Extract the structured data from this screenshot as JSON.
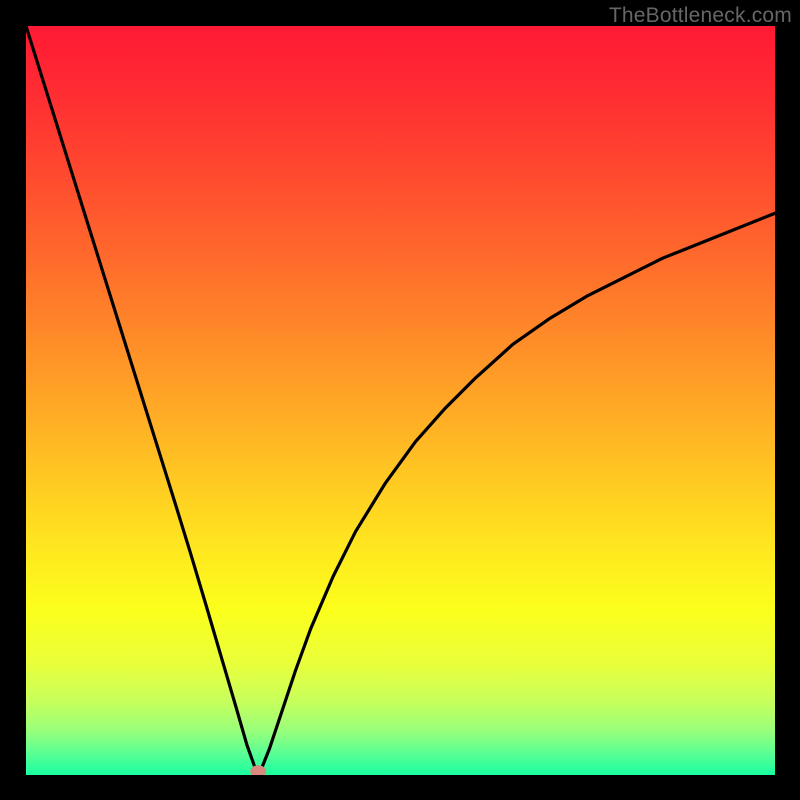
{
  "watermark": {
    "text": "TheBottleneck.com"
  },
  "colors": {
    "gradient_stops": [
      {
        "offset": 0.0,
        "color": "#ff1934"
      },
      {
        "offset": 0.1,
        "color": "#ff2f32"
      },
      {
        "offset": 0.2,
        "color": "#ff4a2f"
      },
      {
        "offset": 0.3,
        "color": "#ff672c"
      },
      {
        "offset": 0.4,
        "color": "#ff8629"
      },
      {
        "offset": 0.5,
        "color": "#ffa626"
      },
      {
        "offset": 0.6,
        "color": "#ffc722"
      },
      {
        "offset": 0.7,
        "color": "#ffe81f"
      },
      {
        "offset": 0.78,
        "color": "#fbff1c"
      },
      {
        "offset": 0.85,
        "color": "#eaff3a"
      },
      {
        "offset": 0.9,
        "color": "#c8ff5a"
      },
      {
        "offset": 0.94,
        "color": "#9aff7a"
      },
      {
        "offset": 0.97,
        "color": "#5cff93"
      },
      {
        "offset": 1.0,
        "color": "#18ffa0"
      }
    ],
    "curve": "#000000",
    "marker": "#d88a7f",
    "background": "#000000"
  },
  "chart_data": {
    "type": "line",
    "title": "",
    "xlabel": "",
    "ylabel": "",
    "xlim": [
      0,
      100
    ],
    "ylim": [
      0,
      100
    ],
    "x": [
      0,
      2,
      4,
      6,
      8,
      10,
      12,
      14,
      16,
      18,
      20,
      22,
      24,
      26,
      28,
      29.5,
      30.5,
      31,
      31.5,
      32.5,
      34,
      36,
      38,
      41,
      44,
      48,
      52,
      56,
      60,
      65,
      70,
      75,
      80,
      85,
      90,
      95,
      100
    ],
    "y": [
      100,
      93.6,
      87.2,
      80.8,
      74.4,
      68.0,
      61.6,
      55.2,
      48.8,
      42.4,
      36.0,
      29.5,
      22.8,
      16.0,
      9.2,
      4.0,
      1.2,
      0.5,
      1.0,
      3.5,
      8.0,
      14.0,
      19.5,
      26.5,
      32.5,
      39.0,
      44.5,
      49.0,
      53.0,
      57.5,
      61.0,
      64.0,
      66.5,
      69.0,
      71.0,
      73.0,
      75.0
    ],
    "marker": {
      "x": 31,
      "y": 0.5
    },
    "legend": []
  }
}
